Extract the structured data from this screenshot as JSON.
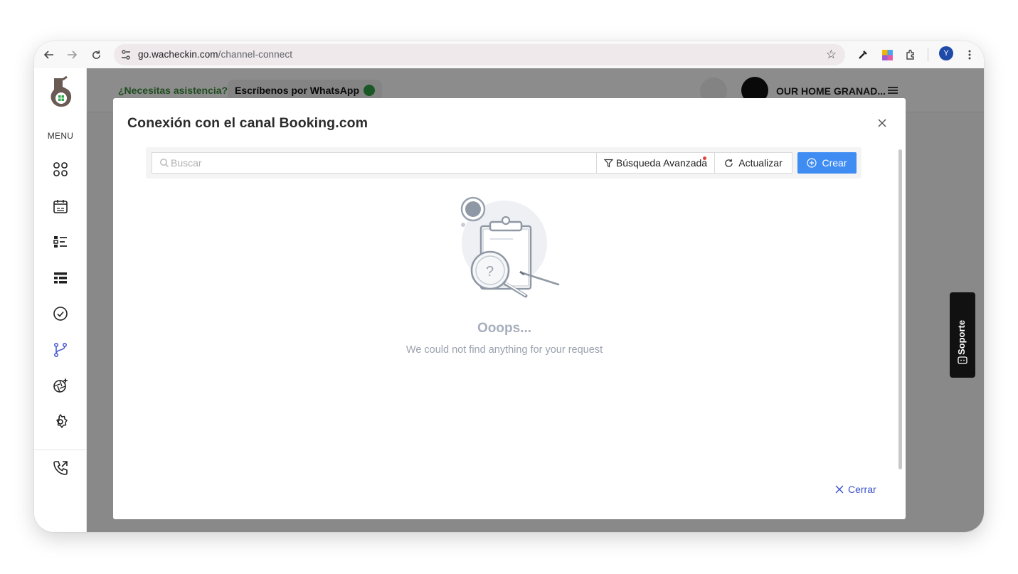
{
  "browser": {
    "url_domain": "go.wacheckin.com",
    "url_path": "/channel-connect",
    "profile_initial": "Y"
  },
  "sidebar": {
    "menu_label": "MENU",
    "icons": [
      "dashboard-icon",
      "calendar-icon",
      "list-icon",
      "table-icon",
      "check-circle-icon",
      "branch-icon",
      "ai-sparkle-icon",
      "settings-icon",
      "phone-icon"
    ]
  },
  "topbar": {
    "assist_text": "¿Necesitas asistencia?",
    "whatsapp_button": "Escríbenos por WhatsApp",
    "hotel_name": "OUR HOME GRANAD..."
  },
  "support_tab": {
    "label": "Soporte"
  },
  "modal": {
    "title": "Conexión con el canal Booking.com",
    "search_placeholder": "Buscar",
    "advanced_search_label": "Búsqueda Avanzada",
    "refresh_label": "Actualizar",
    "create_label": "Crear",
    "empty_title": "Ooops...",
    "empty_subtitle": "We could not find anything for your request",
    "close_label": "Cerrar"
  },
  "colors": {
    "primary_button": "#3f8cf3",
    "link": "#3a50c8",
    "assist_green": "#3a8f3a",
    "active_icon": "#4a5bd1"
  }
}
